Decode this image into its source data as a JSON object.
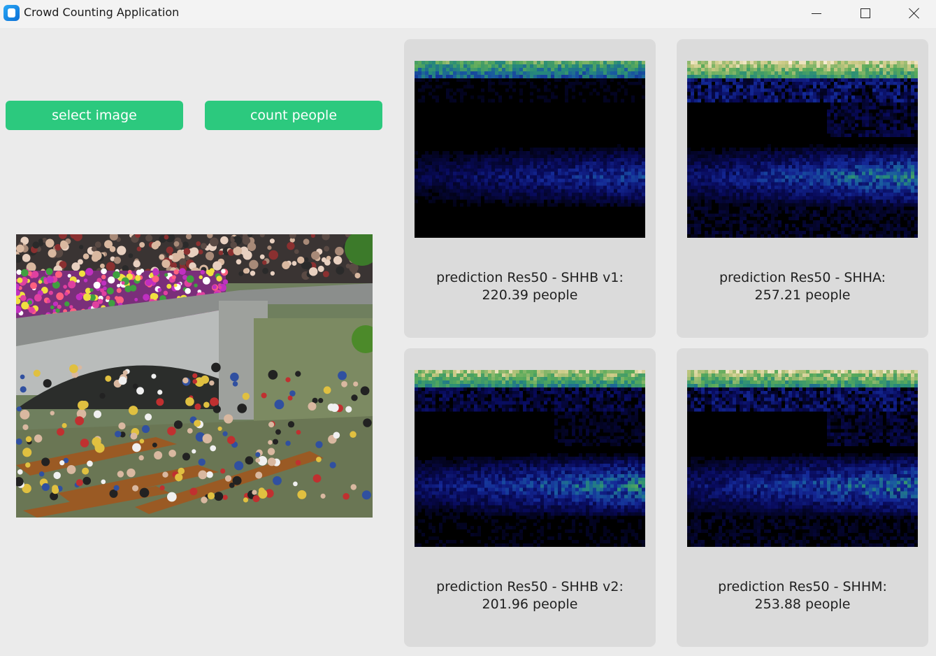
{
  "window": {
    "title": "Crowd Counting Application"
  },
  "controls": {
    "select_label": "select image",
    "count_label": "count people"
  },
  "accent_color": "#2cc97e",
  "photo": {
    "description_icon": "crowd-photo"
  },
  "predictions": [
    {
      "heading": "prediction Res50 - SHHB v1:",
      "value": "220.39 people"
    },
    {
      "heading": "prediction Res50 - SHHA:",
      "value": "257.21 people"
    },
    {
      "heading": "prediction Res50 - SHHB v2:",
      "value": "201.96 people"
    },
    {
      "heading": "prediction Res50 - SHHM:",
      "value": "253.88 people"
    }
  ]
}
